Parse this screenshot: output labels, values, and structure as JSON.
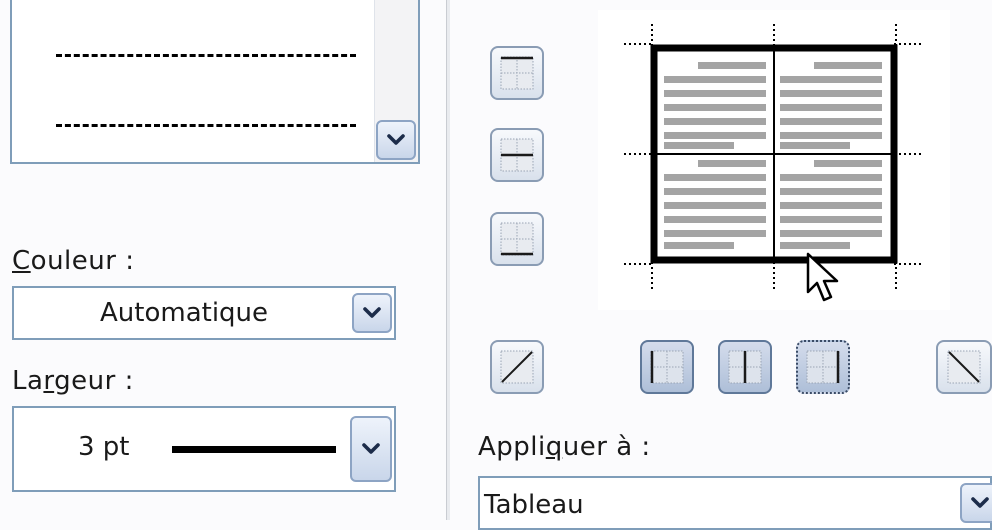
{
  "style_list": {
    "items": [
      "dashed-medium",
      "dashed-wide"
    ]
  },
  "color": {
    "label_accel": "C",
    "label_rest": "ouleur :",
    "value": "Automatique"
  },
  "width": {
    "label_pre": "La",
    "label_accel": "r",
    "label_rest": "geur :",
    "value": "3 pt"
  },
  "apply": {
    "label_pre": "Appli",
    "label_accel": "q",
    "label_rest": "uer à :",
    "value": "Tableau"
  },
  "icons": {
    "dropdown": "chevron-down-icon",
    "cursor": "mouse-pointer-icon"
  },
  "colors": {
    "field_border": "#7f9db9",
    "button_gradient_top": "#eef3fb",
    "button_gradient_bottom": "#c9d6ea",
    "preview_border": "#000000",
    "preview_text_lines": "#a0a0a0"
  }
}
